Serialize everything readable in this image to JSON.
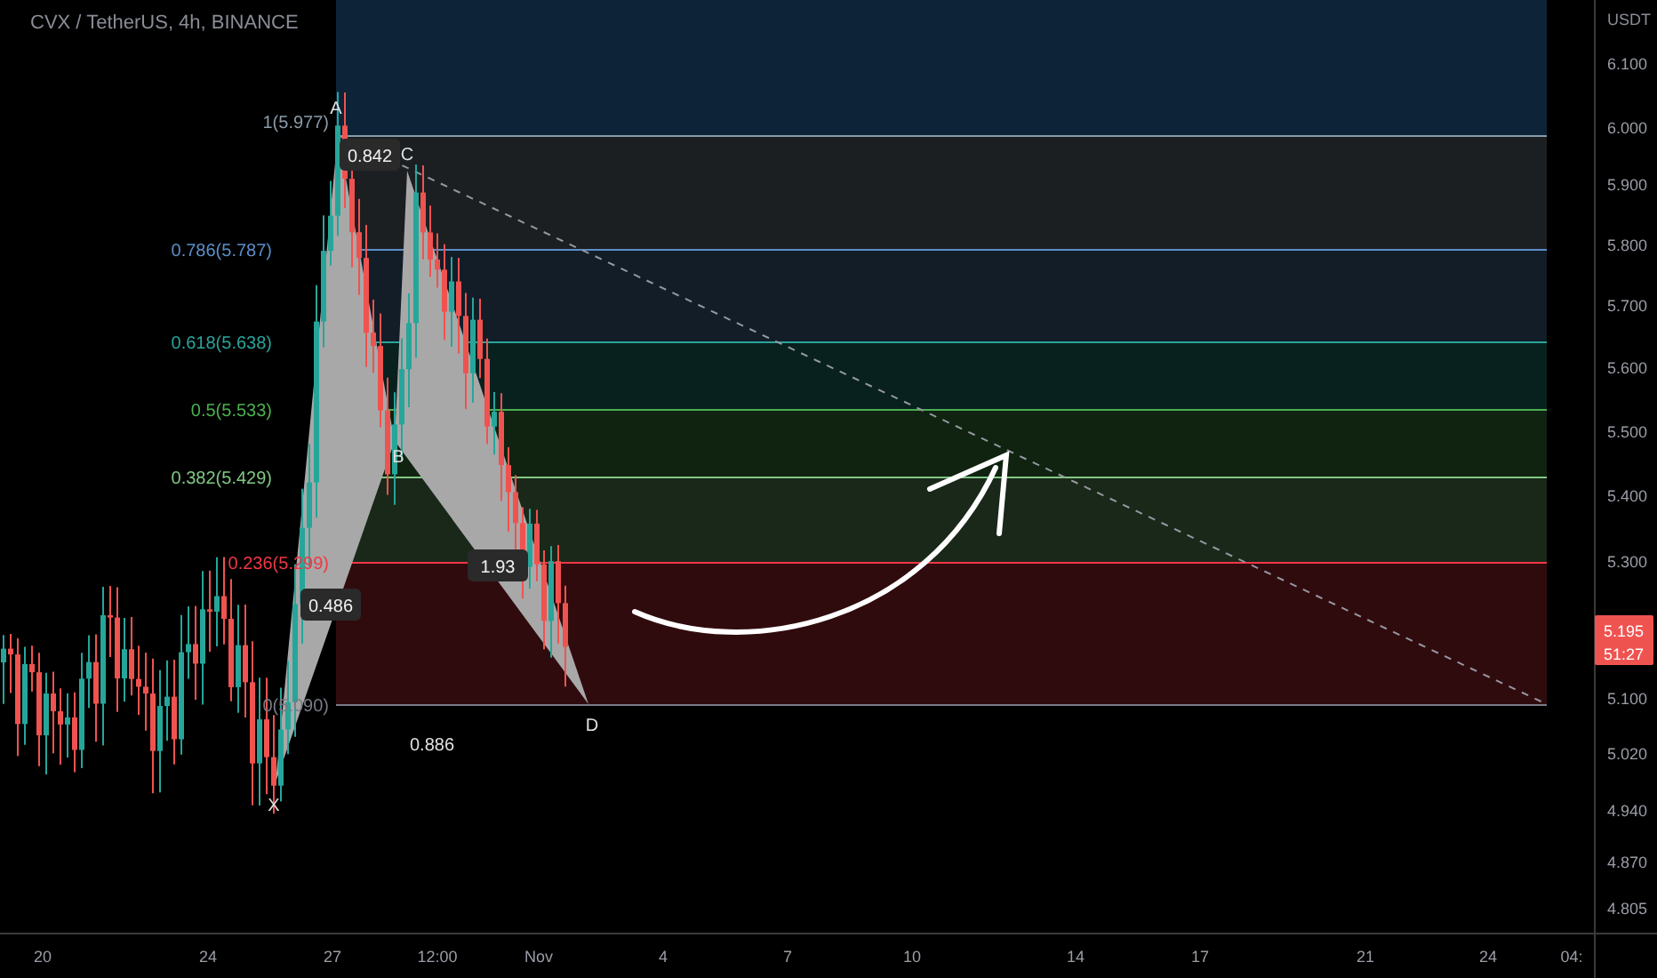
{
  "chart_title": "CVX / TetherUS, 4h, BINANCE",
  "price_axis": {
    "unit": "USDT",
    "ticks": [
      "6.100",
      "6.000",
      "5.900",
      "5.800",
      "5.700",
      "5.600",
      "5.500",
      "5.400",
      "5.300",
      "5.100",
      "5.020",
      "4.940",
      "4.870",
      "4.805"
    ]
  },
  "time_axis": {
    "ticks": [
      "20",
      "24",
      "27",
      "12:00",
      "Nov",
      "4",
      "7",
      "10",
      "14",
      "17",
      "21",
      "24",
      "04:"
    ]
  },
  "fib_levels": [
    {
      "label": "1(5.977)",
      "color": "#8a9aa8"
    },
    {
      "label": "0.786(5.787)",
      "color": "#5b8fc7"
    },
    {
      "label": "0.618(5.638)",
      "color": "#2aa39a"
    },
    {
      "label": "0.5(5.533)",
      "color": "#4caf50"
    },
    {
      "label": "0.382(5.429)",
      "color": "#81c784"
    },
    {
      "label": "0.236(5.299)",
      "color": "#f23645"
    },
    {
      "label": "0(5.090)",
      "color": "#787b86"
    }
  ],
  "pattern_points": [
    "X",
    "A",
    "B",
    "C",
    "D"
  ],
  "pattern_ratios": [
    {
      "text": "0.842",
      "boxed": true
    },
    {
      "text": "0.486",
      "boxed": true
    },
    {
      "text": "1.93",
      "boxed": true
    },
    {
      "text": "0.886",
      "boxed": false
    }
  ],
  "current_price": {
    "price": "5.195",
    "countdown": "51:27"
  }
}
